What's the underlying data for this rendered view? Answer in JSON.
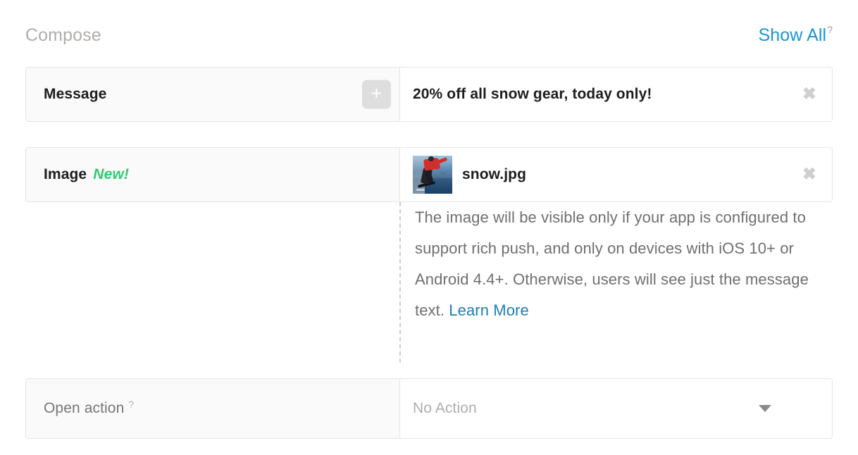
{
  "header": {
    "title": "Compose",
    "show_all_label": "Show All",
    "help_marker": "?"
  },
  "rows": {
    "message": {
      "label": "Message",
      "add_button_glyph": "+",
      "value": "20% off all snow gear, today only!",
      "remove_glyph": "✖"
    },
    "image": {
      "label": "Image",
      "badge": "New!",
      "file_name": "snow.jpg",
      "remove_glyph": "✖",
      "note": "The image will be visible only if your app is configured to support rich push, and only on devices with iOS 10+ or Android 4.4+. Otherwise, users will see just the message text. ",
      "note_link": "Learn More"
    },
    "open_action": {
      "label": "Open action",
      "help_marker": "?",
      "selected_value": "No Action"
    }
  },
  "colors": {
    "link_blue": "#1a96d4",
    "badge_green": "#2ecc71",
    "muted_gray": "#b0aeac",
    "row_label_bg": "#fafafa",
    "border": "#e6e6e6"
  }
}
